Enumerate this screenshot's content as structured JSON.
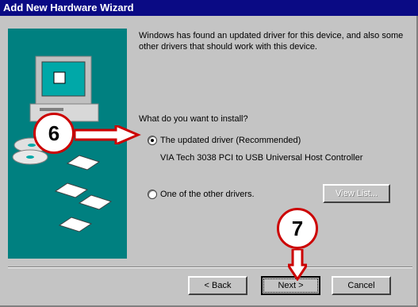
{
  "window": {
    "title": "Add New Hardware Wizard"
  },
  "content": {
    "intro": "Windows has found an updated driver for this device, and also some other drivers that should work with this device.",
    "question": "What do you want to install?",
    "option_updated": {
      "label": "The updated driver (Recommended)",
      "detail": "VIA Tech 3038 PCI to USB Universal Host Controller",
      "selected": true
    },
    "option_other": {
      "label": "One of the other drivers.",
      "selected": false
    },
    "view_list_label": "View List..."
  },
  "buttons": {
    "back": "< Back",
    "next": "Next >",
    "cancel": "Cancel"
  },
  "callouts": {
    "step6": "6",
    "step7": "7"
  },
  "colors": {
    "titlebar": "#0a0a84",
    "window_bg": "#c4c4c4",
    "art_bg": "#008080",
    "callout_border": "#cc0000"
  }
}
